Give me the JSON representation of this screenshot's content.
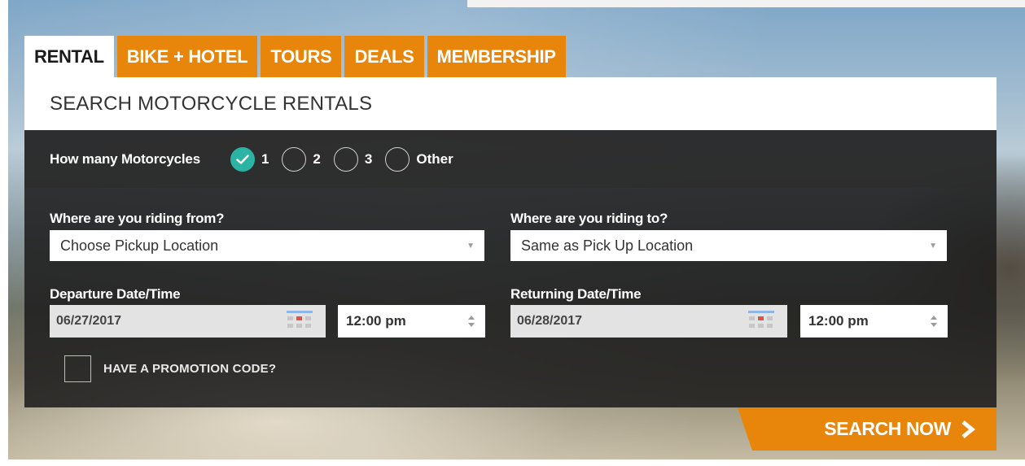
{
  "tabs": [
    {
      "label": "RENTAL",
      "active": true
    },
    {
      "label": "BIKE + HOTEL",
      "active": false
    },
    {
      "label": "TOURS",
      "active": false
    },
    {
      "label": "DEALS",
      "active": false
    },
    {
      "label": "MEMBERSHIP",
      "active": false
    }
  ],
  "panel": {
    "title": "SEARCH MOTORCYCLE RENTALS"
  },
  "count": {
    "label": "How many Motorcycles",
    "options": [
      {
        "label": "1",
        "checked": true
      },
      {
        "label": "2",
        "checked": false
      },
      {
        "label": "3",
        "checked": false
      },
      {
        "label": "Other",
        "checked": false
      }
    ]
  },
  "from": {
    "label": "Where are you riding from?",
    "value": "Choose Pickup Location"
  },
  "to": {
    "label": "Where are you riding to?",
    "value": "Same as Pick Up Location"
  },
  "departure": {
    "label": "Departure Date/Time",
    "date": "06/27/2017",
    "time": "12:00 pm"
  },
  "returning": {
    "label": "Returning Date/Time",
    "date": "06/28/2017",
    "time": "12:00 pm"
  },
  "promo": {
    "label": "HAVE A PROMOTION CODE?"
  },
  "search": {
    "label": "SEARCH NOW"
  },
  "colors": {
    "accent": "#e8860c",
    "check": "#2bb3a3"
  }
}
